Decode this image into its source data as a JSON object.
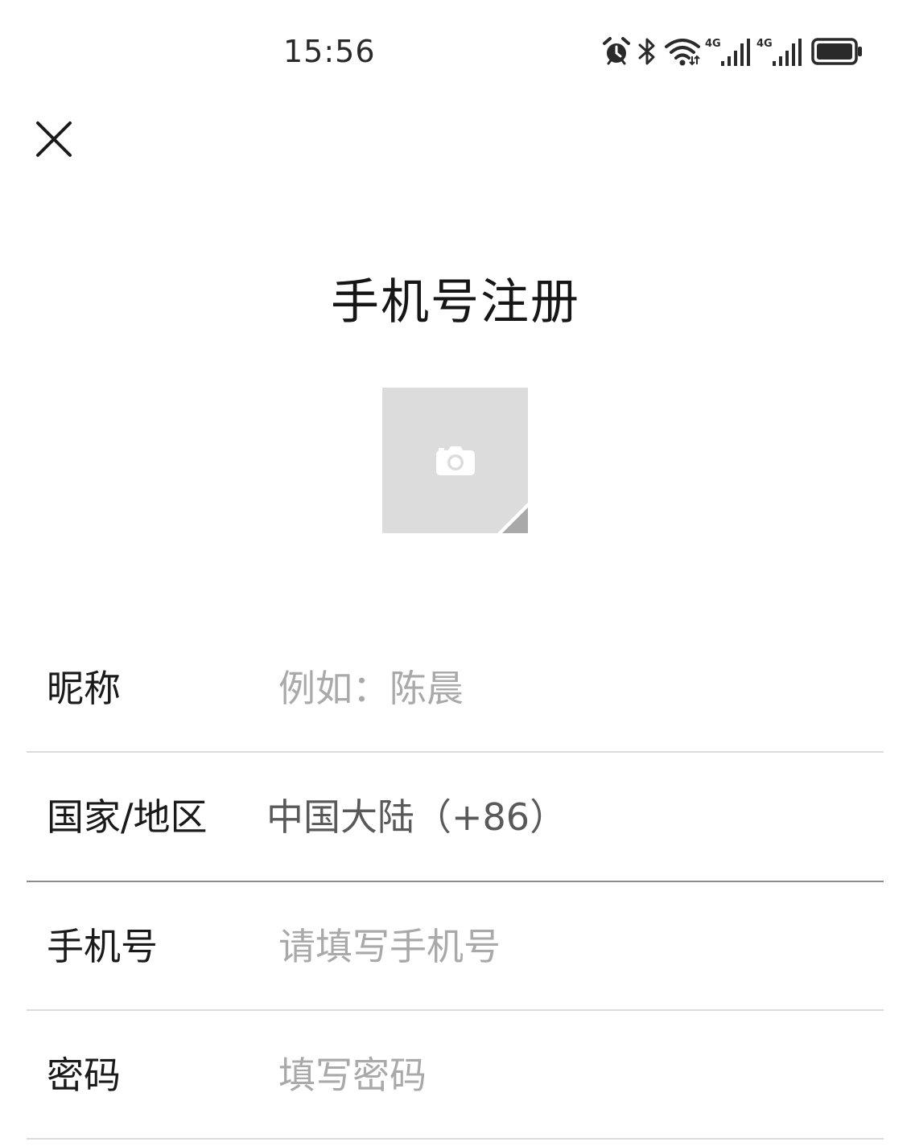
{
  "status_bar": {
    "time": "15:56",
    "icons": [
      "alarm-icon",
      "bluetooth-icon",
      "wifi-icon",
      "signal-4g-icon",
      "signal-4g-icon",
      "battery-icon"
    ],
    "network_labels": [
      "4G",
      "4G"
    ]
  },
  "header": {
    "close_icon": "close-icon",
    "title": "手机号注册"
  },
  "avatar": {
    "icon": "camera-icon"
  },
  "form": {
    "nickname": {
      "label": "昵称",
      "placeholder": "例如：陈晨"
    },
    "region": {
      "label": "国家/地区",
      "value": "中国大陆（+86）"
    },
    "phone": {
      "label": "手机号",
      "placeholder": "请填写手机号"
    },
    "password": {
      "label": "密码",
      "placeholder": "填写密码"
    }
  }
}
